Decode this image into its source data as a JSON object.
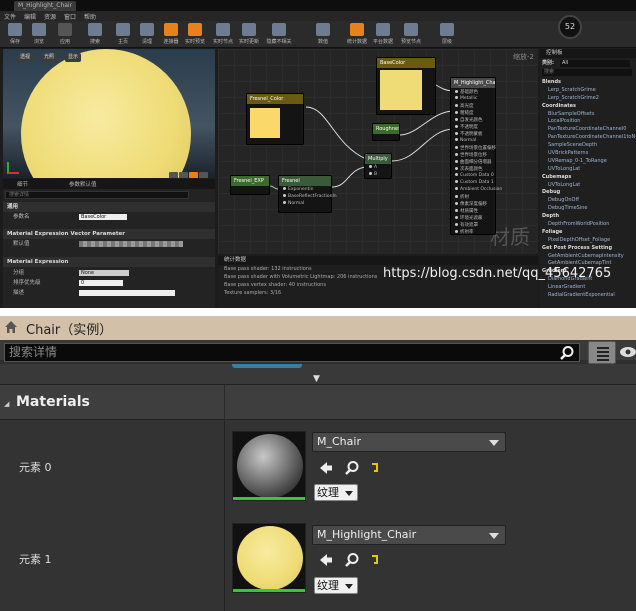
{
  "editor": {
    "window_tab": "M_Highlight_Chair",
    "menu": [
      "文件",
      "编辑",
      "资源",
      "窗口",
      "帮助"
    ],
    "toolbar": [
      {
        "label": "保存",
        "icon": "save-icon"
      },
      {
        "label": "浏览",
        "icon": "browse-icon"
      },
      {
        "label": "应用",
        "icon": "apply-icon"
      },
      {
        "label": "搜索",
        "icon": "search-icon"
      },
      {
        "label": "主页",
        "icon": "home-icon"
      },
      {
        "label": "清理",
        "icon": "clean-icon"
      },
      {
        "label": "连接器",
        "icon": "connectors-icon",
        "active": true
      },
      {
        "label": "实时预览",
        "icon": "live-preview-icon",
        "active": true
      },
      {
        "label": "实时节点",
        "icon": "live-nodes-icon"
      },
      {
        "label": "实时更新",
        "icon": "live-update-icon"
      },
      {
        "label": "隐藏不相关",
        "icon": "hide-unrelated-icon"
      },
      {
        "label": "数值",
        "icon": "stats-icon"
      },
      {
        "label": "统计数据",
        "icon": "statistics-icon",
        "active": true
      },
      {
        "label": "平台数据",
        "icon": "platform-stats-icon"
      },
      {
        "label": "预览节点",
        "icon": "preview-nodes-icon"
      },
      {
        "label": "层级",
        "icon": "hierarchy-icon"
      }
    ],
    "fps": "52",
    "viewport": {
      "btn_perspective": "透视",
      "btn_lit": "光照",
      "btn_show": "显示"
    },
    "details": {
      "tabs": [
        "细节",
        "参数默认值"
      ],
      "search_placeholder": "搜索详情",
      "rows": [
        {
          "type": "cat",
          "label": "通用"
        },
        {
          "type": "kv",
          "key": "参数名",
          "value": "BaseColor"
        },
        {
          "type": "cat",
          "label": "Material Expression Vector Parameter"
        },
        {
          "type": "bar",
          "key": "默认值"
        },
        {
          "type": "cat",
          "label": "Material Expression"
        },
        {
          "type": "kv",
          "key": "分组",
          "value": "None"
        },
        {
          "type": "kv",
          "key": "排序优先级",
          "value": "0"
        },
        {
          "type": "kv",
          "key": "描述",
          "value": ""
        }
      ]
    },
    "graph": {
      "zoom": "缩放-2",
      "watermark": "材质",
      "nodes": {
        "base_color": {
          "title": "BaseColor",
          "subtitle": "Param (1,0.87,0.57,0)"
        },
        "fresnel_color": {
          "title": "Fresnel_Color",
          "subtitle": "Param (1,1,1,1)"
        },
        "fresnel_exp": {
          "title": "Fresnel_EXP",
          "subtitle": "Param (2)"
        },
        "fresnel": {
          "title": "Fresnel",
          "pins": [
            "Exponentin",
            "BaseReflectFractionIn",
            "Normal"
          ]
        },
        "multiply": {
          "title": "Multiply",
          "pins": [
            "A",
            "B"
          ]
        },
        "roughness": {
          "title": "Roughness",
          "subtitle": "Param (0.5)"
        },
        "output": {
          "title": "M_Highlight_Chair",
          "pins": [
            "基础颜色",
            "Metallic",
            "高光度",
            "粗糙度",
            "自发光颜色",
            "不透明度",
            "不透明蒙板",
            "Normal",
            "世界场景位置偏移",
            "世界场景位移",
            "曲面细分倍增器",
            "次表面颜色",
            "Custom Data 0",
            "Custom Data 1",
            "Ambient Occlusion",
            "折射",
            "像素深度偏移",
            "材质属性",
            "环境光遮蔽",
            "有效遮罩",
            "折射率"
          ]
        }
      }
    },
    "stats": {
      "title": "统计数据",
      "lines": [
        "Base pass shader: 132 instructions",
        "Base pass shader with Volumetric Lightmap: 206 instructions",
        "Base pass vertex shader: 40 instructions",
        "Texture samplers: 3/16"
      ]
    },
    "palette": {
      "title": "控制板",
      "category_label": "类别:",
      "category_value": "All",
      "search_placeholder": "搜索",
      "items": [
        {
          "c": true,
          "t": "Blends"
        },
        {
          "t": "Lerp_ScratchGrime"
        },
        {
          "t": "Lerp_ScratchGrime2"
        },
        {
          "c": true,
          "t": "Coordinates"
        },
        {
          "t": "BlurSampleOffsets"
        },
        {
          "t": "LocalPosition"
        },
        {
          "t": "PanTextureCoordinateChannel0"
        },
        {
          "t": "PanTextureCoordinateChannel1toN"
        },
        {
          "t": "SampleSceneDepth"
        },
        {
          "t": "UVBrickPatterns"
        },
        {
          "t": "UVRemap_0-1_ToRange"
        },
        {
          "t": "UVToLongLat"
        },
        {
          "c": true,
          "t": "Cubemaps"
        },
        {
          "t": "UVToLongLat"
        },
        {
          "c": true,
          "t": "Debug"
        },
        {
          "t": "DebugOnOff"
        },
        {
          "t": "DebugTimeSine"
        },
        {
          "c": true,
          "t": "Depth"
        },
        {
          "t": "DepthFromWorldPosition"
        },
        {
          "c": true,
          "t": "Foliage"
        },
        {
          "t": "PixelDepthOffset_Foliage"
        },
        {
          "c": true,
          "t": "Get Post Process Setting"
        },
        {
          "t": "GetAmbientCubemapIntensity"
        },
        {
          "t": "GetAmbientCubemapTint"
        },
        {
          "c": true,
          "t": "Gradient"
        },
        {
          "t": "DiamondGradient"
        },
        {
          "t": "LinearGradient"
        },
        {
          "t": "RadialGradientExponential"
        }
      ]
    }
  },
  "details_panel": {
    "title": "Chair（实例）",
    "search_placeholder": "搜索详情",
    "category": "Materials",
    "elements": [
      {
        "label": "元素 0",
        "material": "M_Chair",
        "texture_btn": "纹理"
      },
      {
        "label": "元素 1",
        "material": "M_Highlight_Chair",
        "texture_btn": "纹理"
      }
    ],
    "colors": {
      "title_bar": "#d2c0a8",
      "accent_green": "#3ac63a"
    }
  },
  "watermark": "https://blog.csdn.net/qq_45642765"
}
